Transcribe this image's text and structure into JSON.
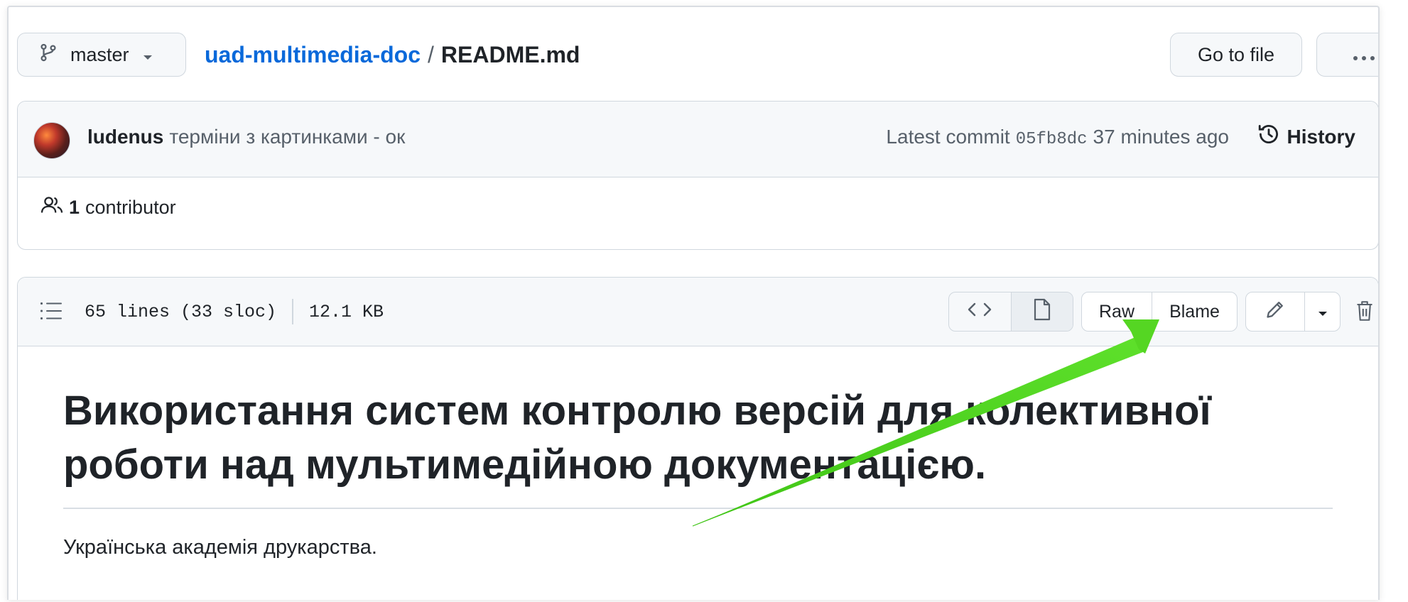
{
  "topbar": {
    "branch": "master",
    "repo": "uad-multimedia-doc",
    "separator": "/",
    "file": "README.md",
    "goto_label": "Go to file",
    "more_label": "···"
  },
  "commit": {
    "author": "ludenus",
    "message": "терміни з картинками - ок",
    "latest_label": "Latest commit",
    "sha": "05fb8dc",
    "time": "37 minutes ago",
    "history_label": "History"
  },
  "contributors": {
    "count": "1",
    "label": "contributor"
  },
  "file": {
    "lines": "65 lines (33 sloc)",
    "size": "12.1 KB",
    "raw_label": "Raw",
    "blame_label": "Blame"
  },
  "readme": {
    "heading": "Використання систем контролю версій для колективної роботи над мультимедійною документацією.",
    "paragraph": "Українська академія друкарства."
  },
  "colors": {
    "link": "#0969da",
    "annotation_arrow": "#4cd41a",
    "header_bg": "#f6f8fa",
    "border": "#d0d7de"
  }
}
